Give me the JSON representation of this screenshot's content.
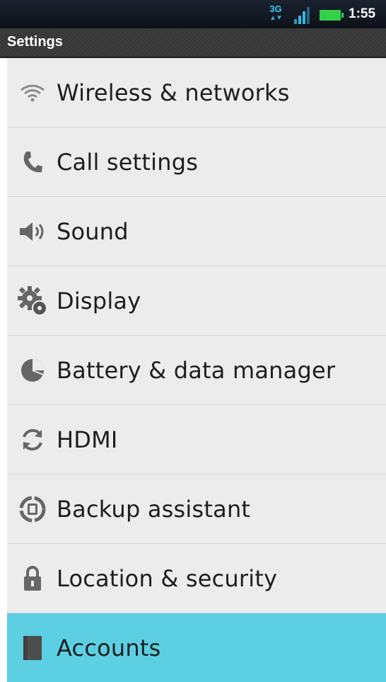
{
  "status_bar": {
    "network_type": "3G",
    "time": "1:55",
    "icons": [
      "network-3g-icon",
      "signal-icon",
      "battery-icon"
    ],
    "battery_color": "#35d04a",
    "signal_color": "#2fb8e8"
  },
  "header": {
    "title": "Settings"
  },
  "settings": {
    "items": [
      {
        "label": "Wireless & networks",
        "icon": "wifi-icon"
      },
      {
        "label": "Call settings",
        "icon": "phone-icon"
      },
      {
        "label": "Sound",
        "icon": "speaker-icon"
      },
      {
        "label": "Display",
        "icon": "display-gear-icon"
      },
      {
        "label": "Battery & data manager",
        "icon": "battery-pie-icon"
      },
      {
        "label": "HDMI",
        "icon": "hdmi-sync-icon"
      },
      {
        "label": "Backup assistant",
        "icon": "backup-icon"
      },
      {
        "label": "Location & security",
        "icon": "lock-icon"
      },
      {
        "label": "Accounts",
        "icon": "accounts-icon",
        "selected": true
      }
    ],
    "selected_color": "#5ccfe3"
  }
}
